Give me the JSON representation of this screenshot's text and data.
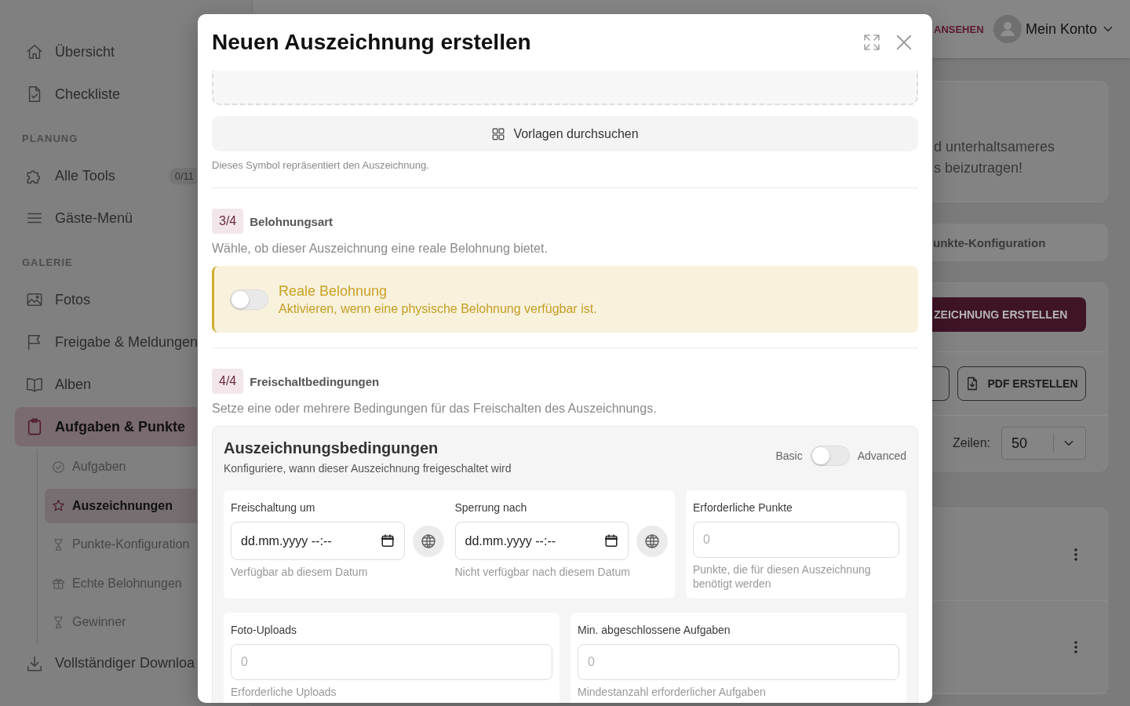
{
  "sidebar": {
    "items": [
      {
        "kind": "link",
        "label": "Übersicht",
        "selected": false
      },
      {
        "kind": "link",
        "label": "Checkliste",
        "selected": false
      },
      {
        "kind": "section",
        "label": "PLANUNG"
      },
      {
        "kind": "link",
        "label": "Alle Tools",
        "badge": "0/11",
        "selected": false
      },
      {
        "kind": "link",
        "label": "Gäste-Menü",
        "selected": false
      },
      {
        "kind": "section",
        "label": "GALERIE"
      },
      {
        "kind": "link",
        "label": "Fotos",
        "selected": false
      },
      {
        "kind": "link",
        "label": "Freigabe & Meldungen",
        "selected": false
      },
      {
        "kind": "link",
        "label": "Alben",
        "selected": false
      },
      {
        "kind": "group",
        "label": "Aufgaben & Punkte",
        "selected": true,
        "children": [
          {
            "label": "Aufgaben",
            "selected": false
          },
          {
            "label": "Auszeichnungen",
            "selected": true
          },
          {
            "label": "Punkte-Konfiguration",
            "selected": false
          },
          {
            "label": "Echte Belohnungen",
            "selected": false
          },
          {
            "label": "Gewinner",
            "selected": false
          }
        ]
      },
      {
        "kind": "link",
        "label": "Vollständiger Downloa",
        "selected": false
      }
    ]
  },
  "header": {
    "link": "ANSEHEN",
    "account": "Mein Konto"
  },
  "page": {
    "intro_lines": [
      "d unterhaltsameres",
      "s beizutragen!"
    ],
    "tab": "unkte-Konfiguration",
    "create_button": "ZEICHNUNG ERSTELLEN",
    "pdf_button": "PDF ERSTELLEN",
    "rows_label": "Zeilen:",
    "rows_value": "50"
  },
  "modal": {
    "title": "Neuen Auszeichnung erstellen",
    "template_button": "Vorlagen durchsuchen",
    "icon_hint": "Dieses Symbol repräsentiert den Auszeichnung.",
    "steps": [
      {
        "kind": "reward",
        "number": "3/4",
        "title": "Belohnungsart",
        "description": "Wähle, ob dieser Auszeichnung eine reale Belohnung bietet."
      },
      {
        "kind": "conditions",
        "number": "4/4",
        "title": "Freischaltbedingungen",
        "description": "Setze eine oder mehrere Bedingungen für das Freischalten des Auszeichnungs."
      }
    ],
    "real_reward": {
      "title": "Reale Belohnung",
      "description": "Aktivieren, wenn eine physische Belohnung verfügbar ist.",
      "on": false
    },
    "conditions": {
      "title": "Auszeichnungsbedingungen",
      "subtitle": "Konfiguriere, wann dieser Auszeichnung freigeschaltet wird",
      "mode_labels": [
        "Basic",
        "Advanced"
      ],
      "advanced": false,
      "date_fields": [
        {
          "label": "Freischaltung um",
          "placeholder": "dd.mm.yyyy --:--",
          "hint": "Verfügbar ab diesem Datum"
        },
        {
          "label": "Sperrung nach",
          "placeholder": "dd.mm.yyyy --:--",
          "hint": "Nicht verfügbar nach diesem Datum"
        }
      ],
      "points_field": {
        "label": "Erforderliche Punkte",
        "placeholder": "0",
        "hint": "Punkte, die für diesen Auszeichnung benötigt werden"
      },
      "count_fields": [
        {
          "label": "Foto-Uploads",
          "placeholder": "0",
          "hint": "Erforderliche Uploads"
        },
        {
          "label": "Min. abgeschlossene Aufgaben",
          "placeholder": "0",
          "hint": "Mindestanzahl erforderlicher Aufgaben"
        }
      ]
    }
  }
}
